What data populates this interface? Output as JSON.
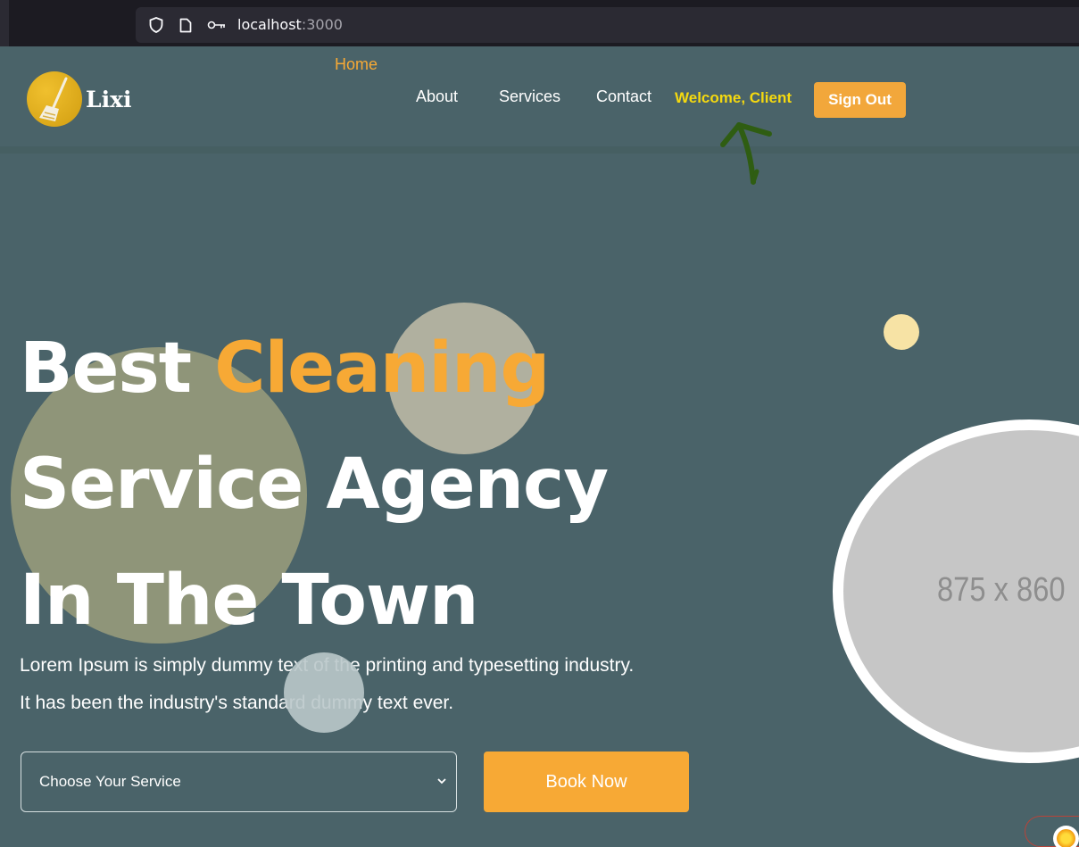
{
  "browser": {
    "url_host": "localhost",
    "url_port": ":3000"
  },
  "header": {
    "logo_text": "Lixi",
    "nav": [
      {
        "label": "Home",
        "active": true
      },
      {
        "label": "About",
        "active": false
      },
      {
        "label": "Services",
        "active": false
      },
      {
        "label": "Contact",
        "active": false
      }
    ],
    "welcome_text": "Welcome, Client",
    "signout_label": "Sign Out"
  },
  "hero": {
    "title_part1": "Best ",
    "title_accent": "Cleaning",
    "title_line2": "Service Agency",
    "title_line3": "In The Town",
    "description": "Lorem Ipsum is simply dummy text of the printing and typesetting industry. It has been the industry's standard dummy text ever.",
    "select_value": "Choose Your Service",
    "book_label": "Book Now",
    "image_placeholder": "875 x 860"
  },
  "colors": {
    "background": "#4a6369",
    "accent": "#f7a935",
    "welcome": "#f5d90f"
  }
}
